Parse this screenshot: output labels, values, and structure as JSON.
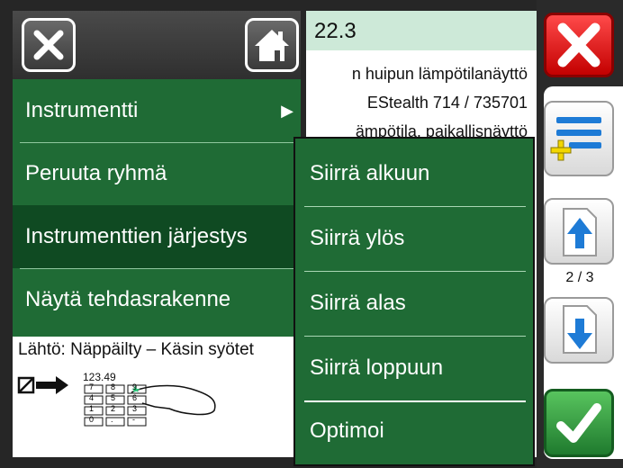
{
  "header": {
    "value": "22.3"
  },
  "content_lines": [
    "n huipun lämpötilanäyttö",
    "EStealth 714 / 735701",
    "ämpötila, paikallisnäyttö"
  ],
  "menu": {
    "items": [
      {
        "label": "Instrumentti",
        "has_submenu": true
      },
      {
        "label": "Peruuta ryhmä",
        "has_submenu": false
      },
      {
        "label": "Instrumenttien järjestys",
        "has_submenu": false,
        "selected": true
      },
      {
        "label": "Näytä tehdasrakenne",
        "has_submenu": false
      }
    ],
    "submenu_arrow": "▶"
  },
  "submenu": {
    "items": [
      {
        "label": "Siirrä alkuun"
      },
      {
        "label": "Siirrä ylös"
      },
      {
        "label": "Siirrä alas"
      },
      {
        "label": "Siirrä loppuun"
      },
      {
        "label": "Optimoi"
      }
    ]
  },
  "source": {
    "label": "Lähtö: Näppäilty – Käsin syötet",
    "display_value": "123.49",
    "keypad_keys": [
      "7",
      "8",
      "9",
      "4",
      "5",
      "6",
      "1",
      "2",
      "3",
      "0",
      ".",
      "-"
    ]
  },
  "sidebar": {
    "page_indicator": "2 / 3"
  },
  "icons": {
    "close": "close-icon",
    "home": "home-icon",
    "menu": "menu-add-icon",
    "up": "page-up-icon",
    "down": "page-down-icon",
    "ok": "checkmark-icon",
    "input": "manual-input-icon",
    "keypad": "keypad-icon"
  },
  "colors": {
    "menu_green": "#1f6b35",
    "menu_selected": "#0f4a22",
    "header_bg": "#cde9d8",
    "close_red": "#e00000",
    "ok_green": "#2e9a3e",
    "accent_blue": "#1e7bd6",
    "accent_yellow": "#f2d600"
  }
}
